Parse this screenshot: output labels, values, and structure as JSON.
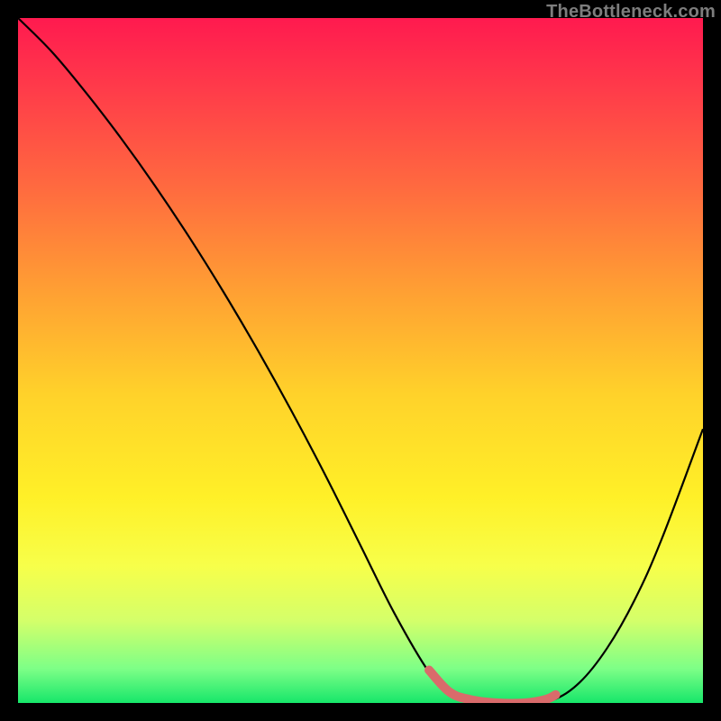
{
  "watermark": "TheBottleneck.com",
  "chart_data": {
    "type": "line",
    "title": "",
    "xlabel": "",
    "ylabel": "",
    "xlim": [
      0,
      100
    ],
    "ylim": [
      0,
      100
    ],
    "background_gradient": {
      "top_color": "#ff1a4f",
      "mid_color": "#ffd22a",
      "bottom_color": "#17e66a",
      "meaning": "red = high bottleneck, green = low bottleneck"
    },
    "series": [
      {
        "name": "bottleneck-curve",
        "color": "#000000",
        "x": [
          0,
          5,
          10,
          15,
          20,
          25,
          30,
          35,
          40,
          45,
          50,
          55,
          60,
          63,
          66,
          70,
          74,
          78,
          82,
          86,
          90,
          94,
          100
        ],
        "values": [
          100,
          95,
          89,
          82.5,
          75.5,
          68,
          60,
          51.5,
          42.5,
          33,
          23,
          13,
          4.5,
          1.5,
          0.4,
          0,
          0,
          0.4,
          3,
          8,
          15,
          24,
          40
        ]
      },
      {
        "name": "optimal-range-highlight",
        "color": "#d96b6b",
        "x": [
          60,
          63,
          66,
          70,
          74,
          77,
          78.5
        ],
        "values": [
          4.8,
          1.6,
          0.5,
          0,
          0,
          0.5,
          1.2
        ]
      }
    ],
    "annotations": []
  }
}
